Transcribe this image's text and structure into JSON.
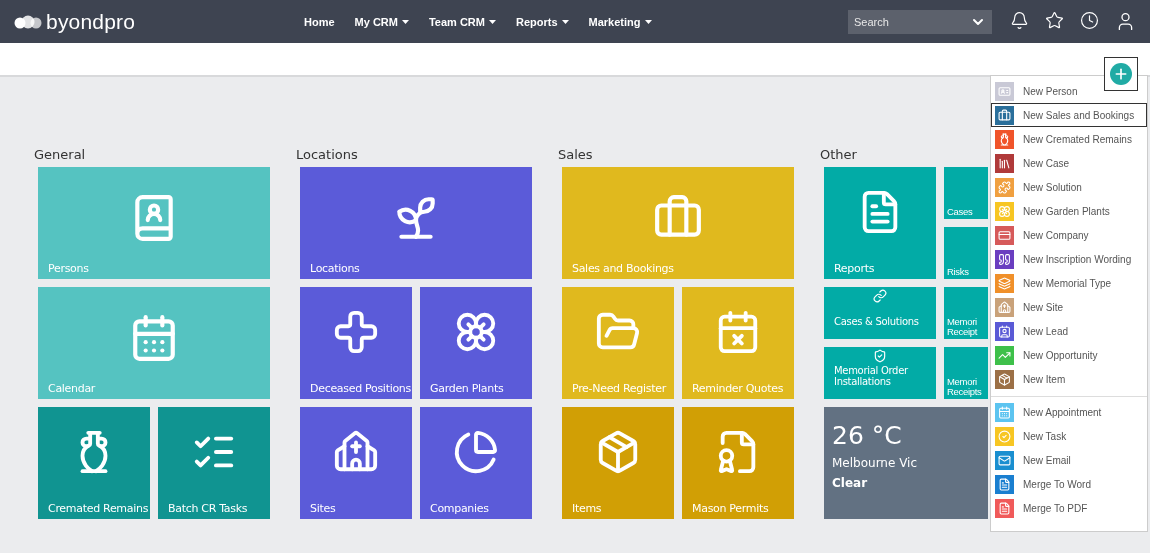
{
  "header": {
    "brand": "byondpro",
    "nav": [
      {
        "label": "Home",
        "dropdown": false
      },
      {
        "label": "My CRM",
        "dropdown": true
      },
      {
        "label": "Team CRM",
        "dropdown": true
      },
      {
        "label": "Reports",
        "dropdown": true
      },
      {
        "label": "Marketing",
        "dropdown": true
      }
    ],
    "search": {
      "placeholder": "Search"
    }
  },
  "groups": [
    {
      "title": "General",
      "tiles": [
        {
          "label": "Persons",
          "kind": "wide",
          "color": "#55c3c1"
        },
        {
          "label": "Calendar",
          "kind": "wide",
          "color": "#55c3c1"
        },
        {
          "label": "Cremated Remains",
          "kind": "small",
          "color": "#109491"
        },
        {
          "label": "Batch CR Tasks",
          "kind": "small",
          "color": "#109491"
        }
      ]
    },
    {
      "title": "Locations",
      "tiles": [
        {
          "label": "Locations",
          "kind": "wide",
          "color": "#5b5bd9"
        },
        {
          "label": "Deceased Positions",
          "kind": "small",
          "color": "#5b5bd9"
        },
        {
          "label": "Garden Plants",
          "kind": "small",
          "color": "#5b5bd9"
        },
        {
          "label": "Sites",
          "kind": "small",
          "color": "#5b5bd9"
        },
        {
          "label": "Companies",
          "kind": "small",
          "color": "#5b5bd9"
        }
      ]
    },
    {
      "title": "Sales",
      "tiles": [
        {
          "label": "Sales and Bookings",
          "kind": "wide",
          "color": "#e0b91e"
        },
        {
          "label": "Pre-Need Register",
          "kind": "small",
          "color": "#e0b91e"
        },
        {
          "label": "Reminder Quotes",
          "kind": "small",
          "color": "#e0b91e"
        },
        {
          "label": "Items",
          "kind": "small",
          "color": "#d19f05"
        },
        {
          "label": "Mason Permits",
          "kind": "small",
          "color": "#d19f05"
        }
      ]
    },
    {
      "title": "Other",
      "tiles": [
        {
          "label": "Cases",
          "kind": "partial",
          "color": "#02aba6"
        },
        {
          "label": "Reports",
          "kind": "small",
          "color": "#02aba6"
        },
        {
          "label": "Risks",
          "kind": "partial",
          "color": "#02aba6"
        },
        {
          "label": "Cases & Solutions",
          "kind": "half",
          "color": "#02aba6"
        },
        {
          "label": "Memori Receipt",
          "kind": "partial",
          "color": "#02aba6"
        },
        {
          "label": "Memorial Order Installations",
          "kind": "half",
          "color": "#02aba6"
        },
        {
          "label": "Memori Receipts",
          "kind": "partial",
          "color": "#02aba6"
        },
        {
          "kind": "weather",
          "color": "#627182",
          "temperature": "26 °C",
          "place": "Melbourne Vic",
          "condition": "Clear"
        }
      ]
    }
  ],
  "menu": {
    "sections": [
      {
        "items": [
          {
            "label": "New Person",
            "selected": false
          },
          {
            "label": "New Sales and Bookings",
            "selected": true
          },
          {
            "label": "New Cremated Remains",
            "selected": false
          },
          {
            "label": "New Case",
            "selected": false
          },
          {
            "label": "New Solution",
            "selected": false
          },
          {
            "label": "New Garden Plants",
            "selected": false
          },
          {
            "label": "New Company",
            "selected": false
          },
          {
            "label": "New Inscription Wording",
            "selected": false
          },
          {
            "label": "New Memorial Type",
            "selected": false
          },
          {
            "label": "New Site",
            "selected": false
          },
          {
            "label": "New Lead",
            "selected": false
          },
          {
            "label": "New Opportunity",
            "selected": false
          },
          {
            "label": "New Item",
            "selected": false
          }
        ]
      },
      {
        "items": [
          {
            "label": "New Appointment",
            "selected": false
          },
          {
            "label": "New Task",
            "selected": false
          },
          {
            "label": "New Email",
            "selected": false
          },
          {
            "label": "Merge To Word",
            "selected": false
          },
          {
            "label": "Merge To PDF",
            "selected": false
          }
        ]
      }
    ]
  }
}
